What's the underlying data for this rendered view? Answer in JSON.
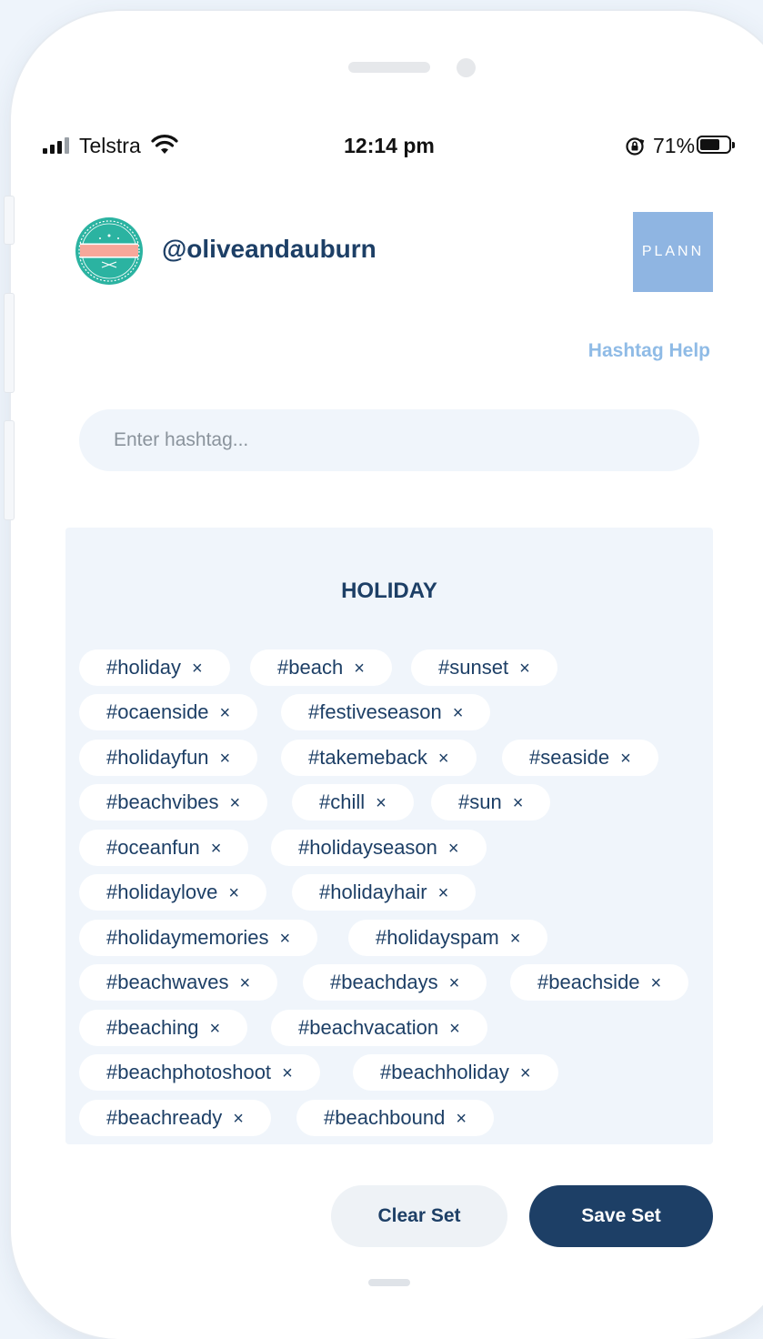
{
  "status_bar": {
    "carrier": "Telstra",
    "time": "12:14 pm",
    "battery_percent": "71%",
    "battery_level": 0.71,
    "icons": [
      "signal-icon",
      "wifi-icon",
      "rotation-lock-icon",
      "battery-icon"
    ]
  },
  "header": {
    "username": "@oliveandauburn",
    "logo_text": "PLANN"
  },
  "help_link": "Hashtag Help",
  "search": {
    "placeholder": "Enter hashtag...",
    "value": ""
  },
  "hashtag_set": {
    "title": "HOLIDAY",
    "remove_symbol": "×",
    "tags": [
      "#holiday",
      "#beach",
      "#sunset",
      "#ocaenside",
      "#festiveseason",
      "#holidayfun",
      "#takemeback",
      "#seaside",
      "#beachvibes",
      "#chill",
      "#sun",
      "#oceanfun",
      "#holidayseason",
      "#holidaylove",
      "#holidayhair",
      "#holidaymemories",
      "#holidayspam",
      "#beachwaves",
      "#beachdays",
      "#beachside",
      "#beaching",
      "#beachvacation",
      "#beachphotoshoot",
      "#beachholiday",
      "#beachready",
      "#beachbound"
    ]
  },
  "actions": {
    "clear": "Clear Set",
    "save": "Save Set"
  },
  "colors": {
    "primary": "#1d3f66",
    "link": "#8fbbe6",
    "panel": "#f0f5fb",
    "logo": "#8fb5e2"
  }
}
